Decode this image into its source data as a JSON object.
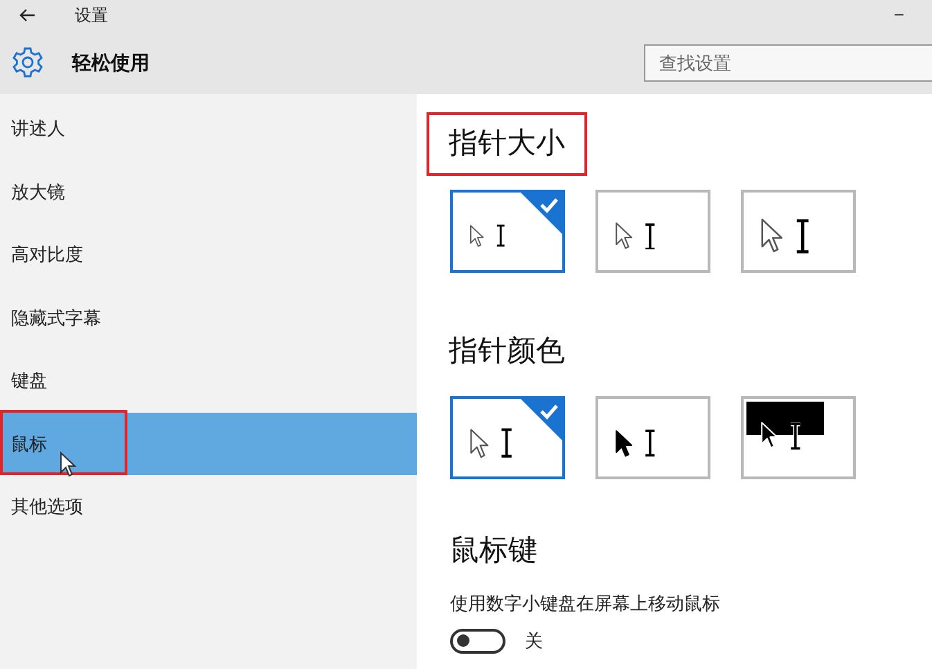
{
  "window": {
    "title": "设置",
    "minimize": "−"
  },
  "header": {
    "title": "轻松使用"
  },
  "search": {
    "placeholder": "查找设置"
  },
  "sidebar": {
    "items": [
      {
        "label": "讲述人",
        "selected": false,
        "highlighted": false
      },
      {
        "label": "放大镜",
        "selected": false,
        "highlighted": false
      },
      {
        "label": "高对比度",
        "selected": false,
        "highlighted": false
      },
      {
        "label": "隐藏式字幕",
        "selected": false,
        "highlighted": false
      },
      {
        "label": "键盘",
        "selected": false,
        "highlighted": false
      },
      {
        "label": "鼠标",
        "selected": true,
        "highlighted": true
      },
      {
        "label": "其他选项",
        "selected": false,
        "highlighted": false
      }
    ]
  },
  "pointer_size": {
    "title": "指针大小",
    "highlighted": true,
    "options": [
      {
        "kind": "small",
        "selected": true
      },
      {
        "kind": "medium",
        "selected": false
      },
      {
        "kind": "large",
        "selected": false
      }
    ]
  },
  "pointer_color": {
    "title": "指针颜色",
    "highlighted": false,
    "options": [
      {
        "kind": "white",
        "selected": true
      },
      {
        "kind": "black",
        "selected": false
      },
      {
        "kind": "inverted",
        "selected": false
      }
    ]
  },
  "mouse_keys": {
    "title": "鼠标键",
    "description": "使用数字小键盘在屏幕上移动鼠标",
    "toggle": {
      "on": false,
      "label": "关"
    }
  }
}
